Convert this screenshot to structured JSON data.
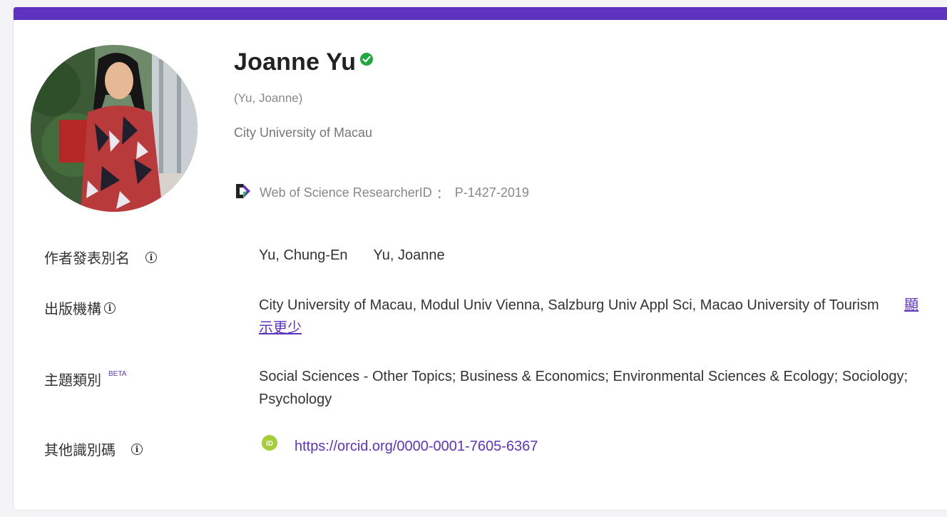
{
  "profile": {
    "name": "Joanne Yu",
    "alt_name": "(Yu, Joanne)",
    "institution": "City University of Macau",
    "researcher_id_label": "Web of Science ResearcherID",
    "researcher_id_sep": "：",
    "researcher_id": "P-1427-2019"
  },
  "rows": {
    "aliases": {
      "label": "作者發表別名",
      "values": [
        "Yu, Chung-En",
        "Yu, Joanne"
      ]
    },
    "organizations": {
      "label": "出版機構",
      "value": "City University of Macau,  Modul Univ Vienna,  Salzburg Univ Appl Sci,  Macao University of Tourism",
      "toggle": "顯示更少"
    },
    "categories": {
      "label": "主題類別",
      "badge": "BETA",
      "value": "Social Sciences - Other Topics;  Business & Economics;  Environmental Sciences & Ecology;  Sociology;  Psychology"
    },
    "identifiers": {
      "label": "其他識別碼",
      "orcid_badge": "iD",
      "orcid_url": "https://orcid.org/0000-0001-7605-6367"
    }
  },
  "colors": {
    "accent": "#5e33bf",
    "verified": "#1fa83f",
    "orcid": "#a6ce39"
  },
  "icons": [
    "verified-check-icon",
    "web-of-science-icon",
    "info-icon",
    "orcid-icon"
  ]
}
